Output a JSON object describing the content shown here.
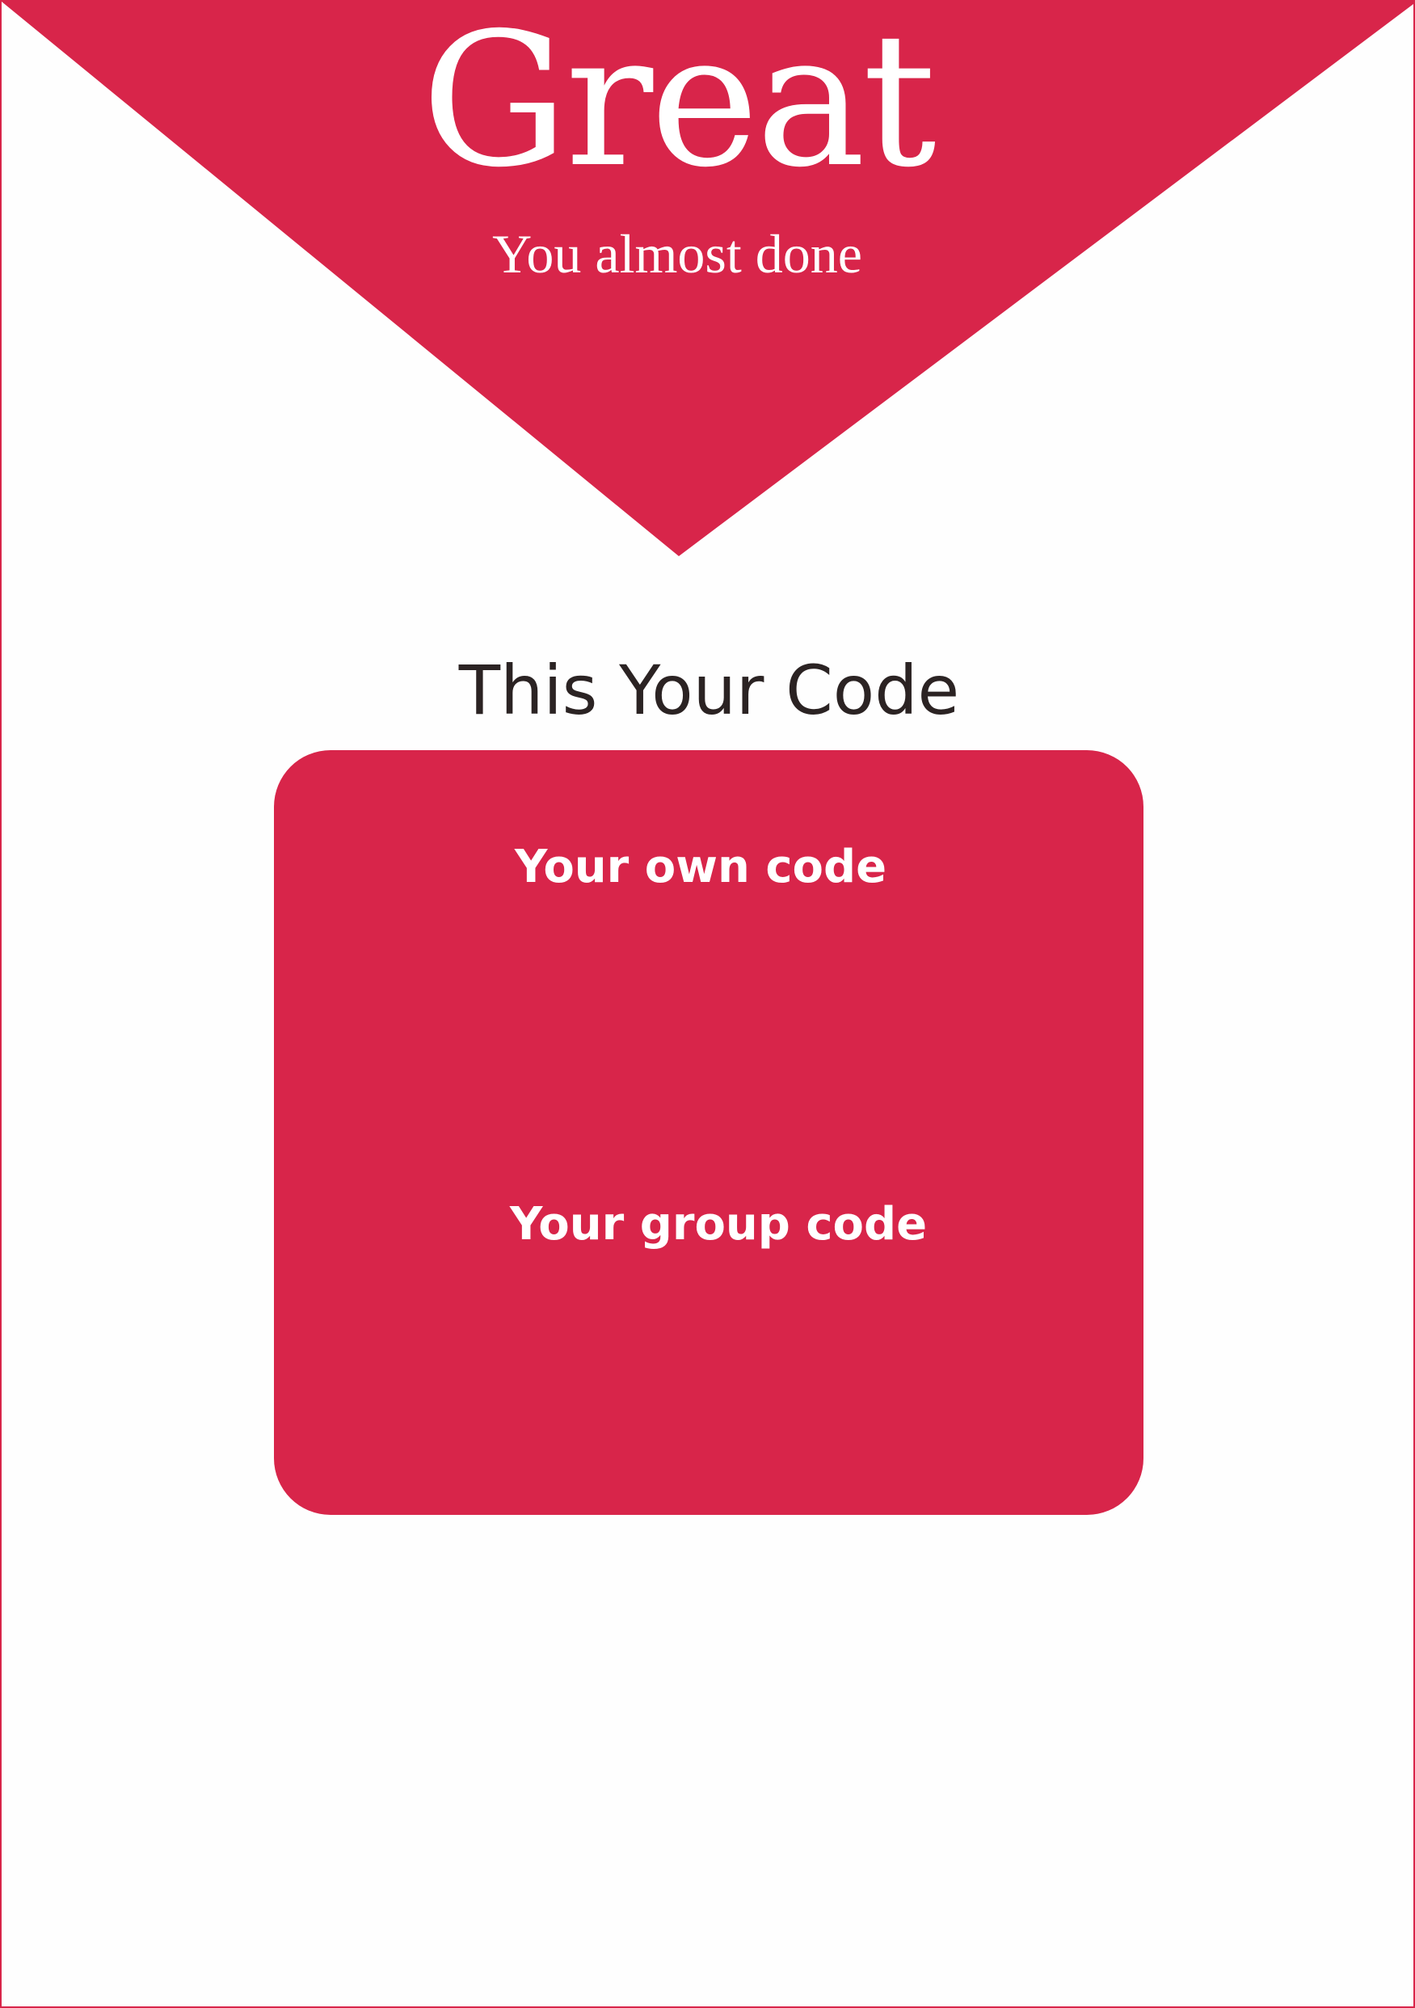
{
  "header": {
    "title": "Great",
    "subtitle": "You almost done"
  },
  "section": {
    "title": "This Your Code"
  },
  "codes": {
    "own_label": "Your own code",
    "own_value": "",
    "group_label": "Your group code",
    "group_value": ""
  },
  "colors": {
    "accent": "#d8254a",
    "background": "#fefefe",
    "heading_text": "#2b2323",
    "on_accent_text": "#ffffff"
  }
}
